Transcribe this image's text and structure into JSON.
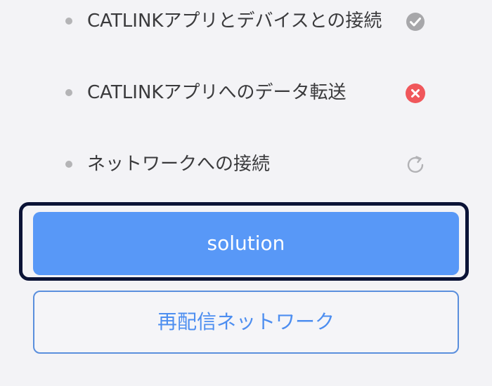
{
  "status_items": [
    {
      "label": "CATLINKアプリとデバイスとの接続",
      "status": "done",
      "icon": "check-circle-icon"
    },
    {
      "label": "CATLINKアプリへのデータ転送",
      "status": "failed",
      "icon": "error-x-icon"
    },
    {
      "label": "ネットワークへの接続",
      "status": "pending",
      "icon": "refresh-icon"
    }
  ],
  "buttons": {
    "solution_label": "solution",
    "resend_label": "再配信ネットワーク"
  },
  "colors": {
    "background": "#f3f3f6",
    "bullet": "#b4b4b6",
    "label_text": "#3a3a3c",
    "success_gray": "#a7a7aa",
    "error_red": "#f0575b",
    "pending_gray": "#b2b2b5",
    "primary_button": "#5898f7",
    "secondary_border": "#5a8fdd",
    "secondary_text": "#4d8ef0",
    "focus_outline": "#0b1336"
  }
}
